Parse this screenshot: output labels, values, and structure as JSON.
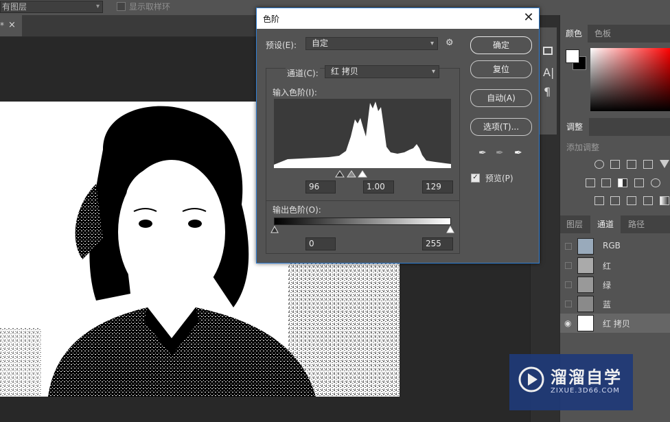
{
  "options_bar": {
    "layer_sample_value": "有图层",
    "show_sample_ring_label": "显示取样环"
  },
  "document_tab": {
    "title": "*",
    "close": "×"
  },
  "dialog": {
    "title": "色阶",
    "close": "✕",
    "preset_label": "预设(E):",
    "preset_value": "自定",
    "channel_label": "通道(C):",
    "channel_value": "红 拷贝",
    "input_levels_label": "输入色阶(I):",
    "input_black": "96",
    "input_gamma": "1.00",
    "input_white": "129",
    "output_levels_label": "输出色阶(O):",
    "output_black": "0",
    "output_white": "255",
    "buttons": {
      "ok": "确定",
      "reset": "复位",
      "auto": "自动(A)",
      "options": "选项(T)..."
    },
    "preview_label": "预览(P)",
    "preview_checked": true
  },
  "right_panel": {
    "color_tabs": [
      "颜色",
      "色板"
    ],
    "adjust_tab": "调整",
    "adjust_subtitle": "添加调整",
    "layer_tabs": [
      "图层",
      "通道",
      "路径"
    ],
    "active_layer_tab": "通道",
    "channels": [
      {
        "name": "RGB",
        "visible": false
      },
      {
        "name": "红",
        "visible": false
      },
      {
        "name": "绿",
        "visible": false
      },
      {
        "name": "蓝",
        "visible": false
      },
      {
        "name": "红 拷贝",
        "visible": true
      }
    ]
  },
  "watermark": {
    "title": "溜溜自学",
    "subtitle": "ZIXUE.3D66.COM"
  },
  "colors": {
    "dialog_border": "#2f7fd5",
    "panel_bg": "#535353",
    "watermark_bg": "#1f3a78"
  }
}
